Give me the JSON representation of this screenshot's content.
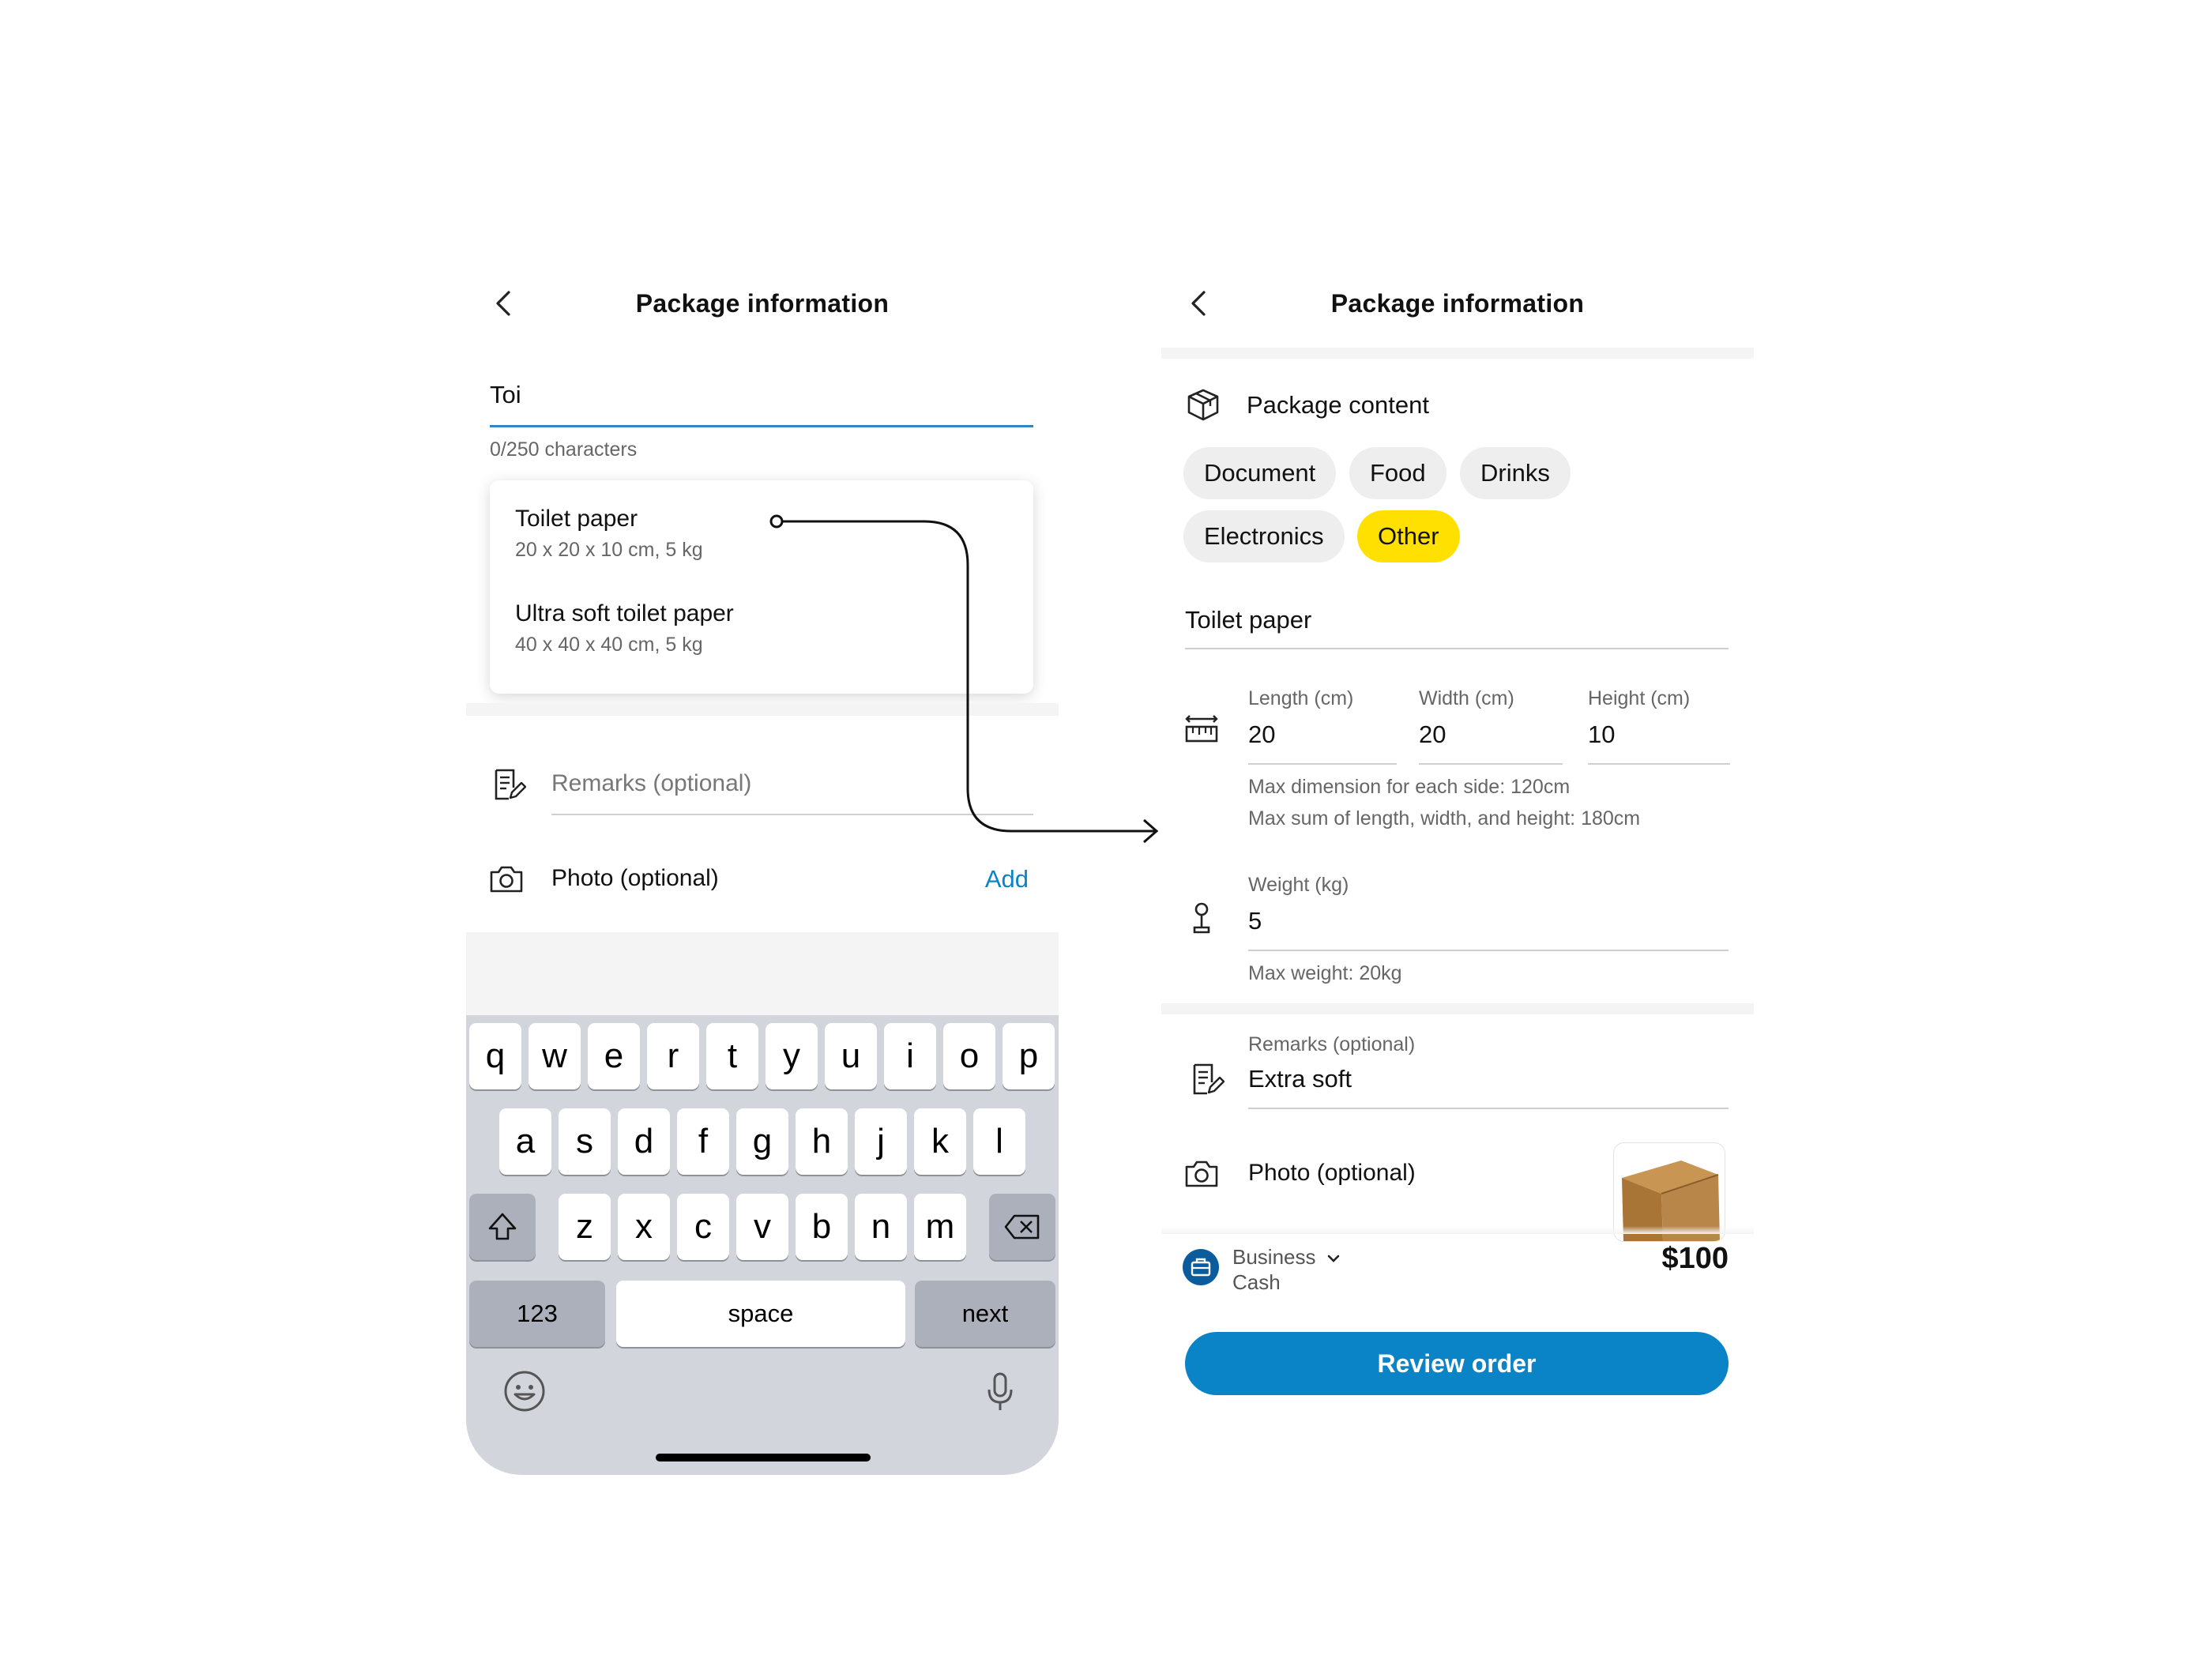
{
  "left": {
    "title": "Package information",
    "search_value": "Toi",
    "char_count": "0/250 characters",
    "suggestions": [
      {
        "title": "Toilet paper",
        "sub": "20 x 20 x 10 cm, 5 kg"
      },
      {
        "title": "Ultra soft toilet paper",
        "sub": "40 x 40 x 40 cm, 5 kg"
      }
    ],
    "remarks_placeholder": "Remarks (optional)",
    "photo_label": "Photo (optional)",
    "add_label": "Add",
    "keyboard": {
      "row1": [
        "q",
        "w",
        "e",
        "r",
        "t",
        "y",
        "u",
        "i",
        "o",
        "p"
      ],
      "row2": [
        "a",
        "s",
        "d",
        "f",
        "g",
        "h",
        "j",
        "k",
        "l"
      ],
      "row3": [
        "z",
        "x",
        "c",
        "v",
        "b",
        "n",
        "m"
      ],
      "numbers": "123",
      "space": "space",
      "next": "next"
    }
  },
  "right": {
    "title": "Package information",
    "content_title": "Package content",
    "chips": [
      "Document",
      "Food",
      "Drinks",
      "Electronics",
      "Other"
    ],
    "selected_chip": "Other",
    "item_name": "Toilet paper",
    "length_label": "Length (cm)",
    "length_value": "20",
    "width_label": "Width (cm)",
    "width_value": "20",
    "height_label": "Height (cm)",
    "height_value": "10",
    "hint_dimension": "Max dimension for each side: 120cm",
    "hint_sum": "Max sum of length, width, and height: 180cm",
    "weight_label": "Weight (kg)",
    "weight_value": "5",
    "hint_weight": "Max weight: 20kg",
    "remarks_label": "Remarks (optional)",
    "remarks_value": "Extra soft",
    "photo_label": "Photo (optional)",
    "payment_account": "Business",
    "payment_method": "Cash",
    "price": "$100",
    "review_button": "Review order"
  },
  "colors": {
    "accent_blue": "#0a84c6",
    "selected_chip": "#ffe000",
    "input_focus": "#2e86c9"
  },
  "icons": [
    "chevron-left-icon",
    "package-icon",
    "ruler-icon",
    "weight-icon",
    "notes-icon",
    "camera-icon",
    "business-briefcase-icon",
    "chevron-down-icon",
    "shift-icon",
    "backspace-icon",
    "emoji-icon",
    "microphone-icon"
  ]
}
